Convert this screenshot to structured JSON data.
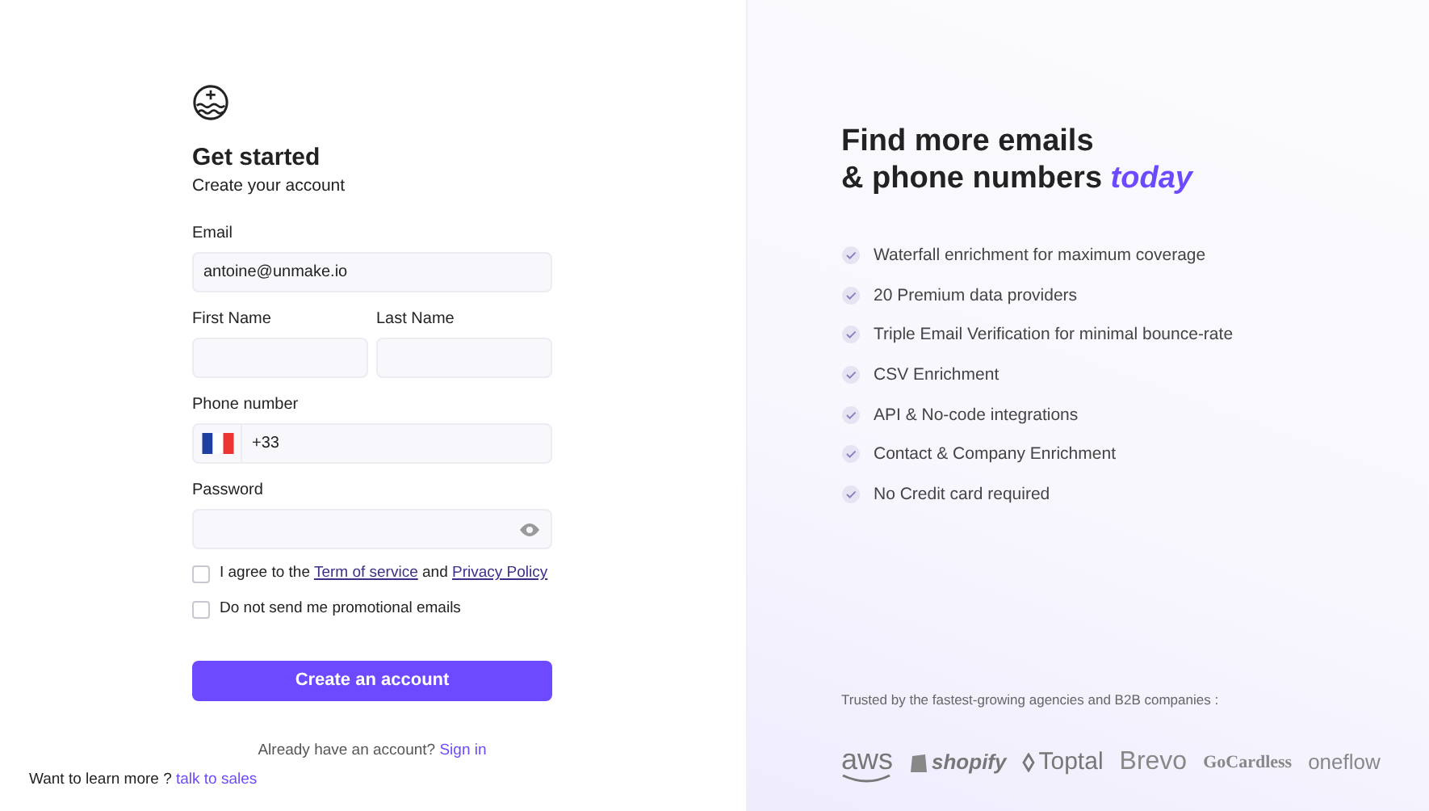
{
  "form": {
    "title": "Get started",
    "subtitle": "Create your account",
    "email": {
      "label": "Email",
      "value": "antoine@unmake.io"
    },
    "first_name": {
      "label": "First Name"
    },
    "last_name": {
      "label": "Last Name"
    },
    "phone": {
      "label": "Phone number",
      "value": "+33"
    },
    "password": {
      "label": "Password"
    },
    "terms": {
      "checked": false,
      "before": "I agree to the",
      "link1": "Term of service",
      "middle": "and",
      "link2": "Privacy Policy"
    },
    "promo": {
      "checked": false,
      "label": "Do not send me promotional emails"
    },
    "submit": "Create an account",
    "signin": {
      "text": "Already have an account?",
      "link": "Sign in"
    }
  },
  "sales": {
    "text": "Want to learn more ?",
    "link": "talk to sales"
  },
  "promo_panel": {
    "headline_line1": "Find more emails",
    "headline_line2": "& phone numbers *today*",
    "features": [
      "Waterfall enrichment for maximum coverage",
      "20 Premium data providers",
      "Triple Email Verification for minimal bounce-rate",
      "CSV Enrichment",
      "API & No-code integrations",
      "Contact & Company Enrichment",
      "No Credit card required"
    ],
    "trusted": "Trusted by the fastest-growing agencies and B2B companies :",
    "logos": [
      {
        "kind": "aws",
        "text": "aws"
      },
      {
        "kind": "shopify",
        "text": "shopify"
      },
      {
        "kind": "toptal",
        "text": "Toptal"
      },
      {
        "kind": "brevo",
        "text": "Brevo"
      },
      {
        "kind": "gocardless",
        "text": "GoCardless"
      },
      {
        "kind": "oneflow",
        "text": "oneflow"
      }
    ]
  }
}
